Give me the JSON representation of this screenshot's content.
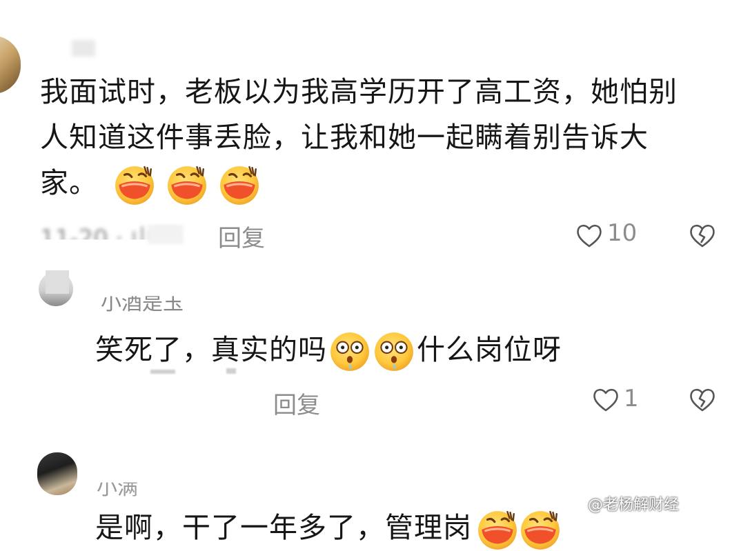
{
  "comments": [
    {
      "text": "我面试时，老板以为我高学历开了高工资，她怕别人知道这件事丢脸，让我和她一起瞒着别告诉大家。",
      "text_lines": [
        "我面试时，老板以为我高学历开了高工资，她怕别",
        "人知道这件事丢脸，让我和她一起瞒着别告诉大",
        "家。"
      ],
      "emojis": [
        "laughing-cry-emoji",
        "laughing-cry-emoji",
        "laughing-cry-emoji"
      ],
      "meta": "11-20 · 山西",
      "reply_label": "回复",
      "like_count": "10"
    },
    {
      "username": "小酒是玉",
      "text_before": "笑死了，真实的吗",
      "text_after": "什么岗位呀",
      "emojis": [
        "shocked-emoji",
        "shocked-emoji"
      ],
      "reply_label": "回复",
      "like_count": "1"
    },
    {
      "username": "小满",
      "text": "是啊，干了一年多了，管理岗",
      "emojis": [
        "laughing-cry-emoji",
        "laughing-cry-emoji"
      ]
    }
  ],
  "watermark": {
    "text": "@老杨解财经"
  },
  "colors": {
    "text": "#161616",
    "meta": "#8c8c8c",
    "emoji_face": "#ffc83d",
    "emoji_mouth": "#f0502a"
  }
}
